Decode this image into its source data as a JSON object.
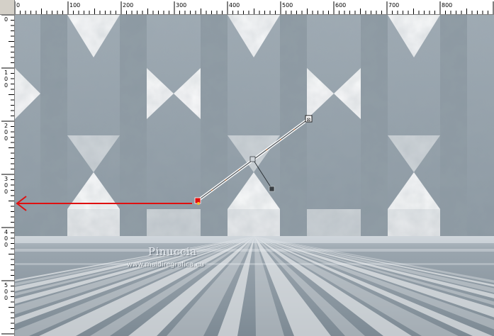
{
  "ruler_top": {
    "labels": [
      "0",
      "100",
      "200",
      "300",
      "400",
      "500",
      "600",
      "700",
      "800"
    ]
  },
  "ruler_left": {
    "labels": [
      [
        "0"
      ],
      [
        "1",
        "0",
        "0"
      ],
      [
        "2",
        "0",
        "0"
      ],
      [
        "3",
        "0",
        "0"
      ],
      [
        "4",
        "0",
        "0"
      ],
      [
        "5",
        "0",
        "0"
      ]
    ]
  },
  "watermark": {
    "title": "Pinuccia",
    "url": "www.maidireg rafica.eu"
  },
  "colors": {
    "ruler_bg": "#ffffff",
    "panel_bg": "#d4d0c8",
    "texture": "#8f9ca6",
    "arrow": "#e01010"
  },
  "tool": {
    "name": "pick-tool-deformation-handle"
  }
}
